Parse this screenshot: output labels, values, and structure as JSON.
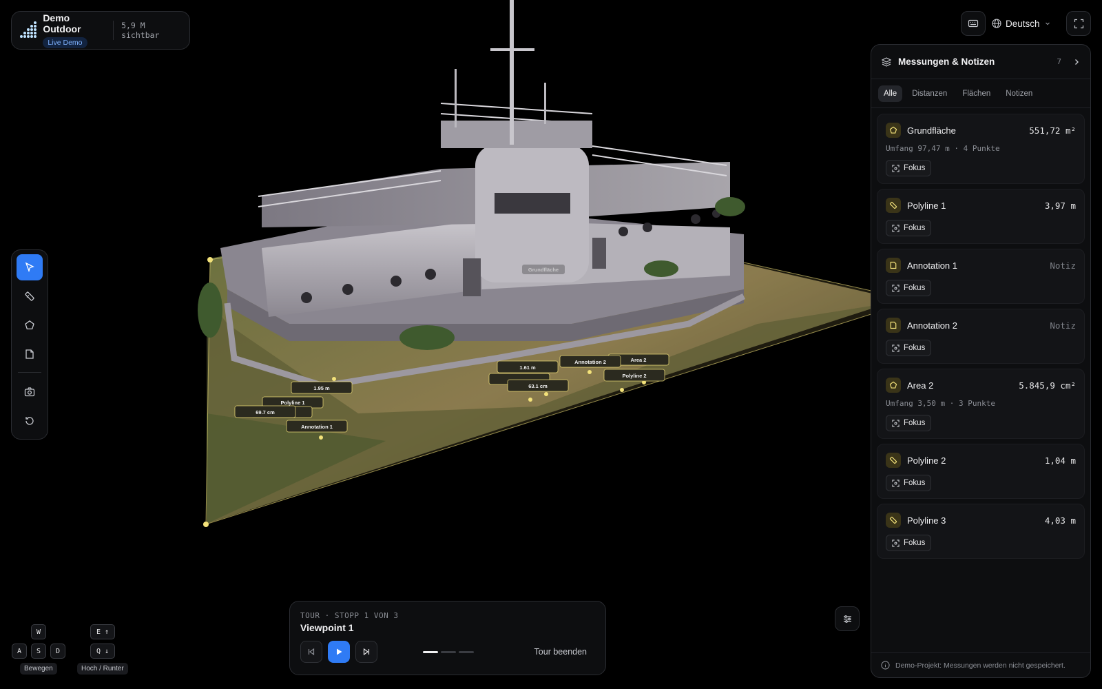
{
  "project": {
    "title": "Demo Outdoor",
    "badge": "Live Demo",
    "visible_points": "5,9 M sichtbar"
  },
  "topbar": {
    "language": "Deutsch",
    "keyboard_icon": "keyboard-icon",
    "fullscreen_icon": "fullscreen-icon"
  },
  "toolbar": {
    "tools": [
      "select-cursor-icon",
      "ruler-icon",
      "polygon-icon",
      "note-icon",
      "camera-icon",
      "reset-icon"
    ]
  },
  "panel": {
    "title": "Messungen & Notizen",
    "count": "7",
    "tabs": [
      "Alle",
      "Distanzen",
      "Flächen",
      "Notizen"
    ],
    "active_tab": "Alle",
    "focus_label": "Fokus",
    "items": [
      {
        "name": "Grundfläche",
        "value": "551,72 m²",
        "meta": "Umfang 97,47 m · 4 Punkte",
        "icon": "polygon-icon"
      },
      {
        "name": "Polyline 1",
        "value": "3,97 m",
        "icon": "ruler-icon"
      },
      {
        "name": "Annotation 1",
        "value": "Notiz",
        "icon": "note-icon"
      },
      {
        "name": "Annotation 2",
        "value": "Notiz",
        "icon": "note-icon"
      },
      {
        "name": "Area 2",
        "value": "5.845,9 cm²",
        "meta": "Umfang 3,50 m · 3 Punkte",
        "icon": "polygon-icon"
      },
      {
        "name": "Polyline 2",
        "value": "1,04 m",
        "icon": "ruler-icon"
      },
      {
        "name": "Polyline 3",
        "value": "4,03 m",
        "icon": "ruler-icon"
      }
    ],
    "footer": "Demo-Projekt: Messungen werden nicht gespeichert."
  },
  "tour": {
    "label": "TOUR · STOPP 1 VON 3",
    "title": "Viewpoint 1",
    "end_label": "Tour beenden",
    "current_stop": 1,
    "total_stops": 3
  },
  "keys": {
    "move": [
      "W",
      "A",
      "S",
      "D"
    ],
    "move_label": "Bewegen",
    "updown": [
      "E ↑",
      "Q ↓"
    ],
    "updown_label": "Hoch / Runter"
  },
  "scene_labels": {
    "grundflaeche": "Grundfläche",
    "l1": "1.95 m",
    "l2": "Polyline 1",
    "l3": "69.7 cm",
    "l4": "Annotation 1",
    "l5": "1.61 m",
    "l6": "63.1 cm",
    "l7": "Annotation 2",
    "l8": "Area 2",
    "l9": "Polyline 2"
  },
  "colors": {
    "accent": "#2f7bf5",
    "measure_yellow": "#f3e27a",
    "panel_bg": "#0d0e10"
  }
}
